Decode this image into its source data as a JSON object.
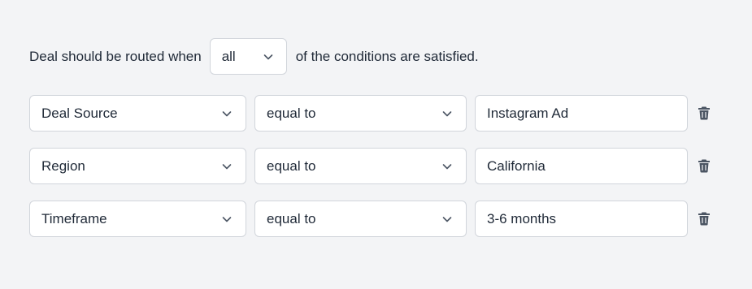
{
  "rule": {
    "prefix": "Deal should be routed when",
    "match_value": "all",
    "suffix": "of the conditions are satisfied."
  },
  "conditions": [
    {
      "field": "Deal Source",
      "operator": "equal to",
      "value": "Instagram Ad"
    },
    {
      "field": "Region",
      "operator": "equal to",
      "value": "California"
    },
    {
      "field": "Timeframe",
      "operator": "equal to",
      "value": "3-6 months"
    }
  ],
  "icons": {
    "dropdown": "chevron-down-icon",
    "delete": "trash-icon"
  },
  "colors": {
    "background": "#f3f4f6",
    "text": "#1f2937",
    "border": "#d1d5db",
    "icon": "#4b5563"
  }
}
